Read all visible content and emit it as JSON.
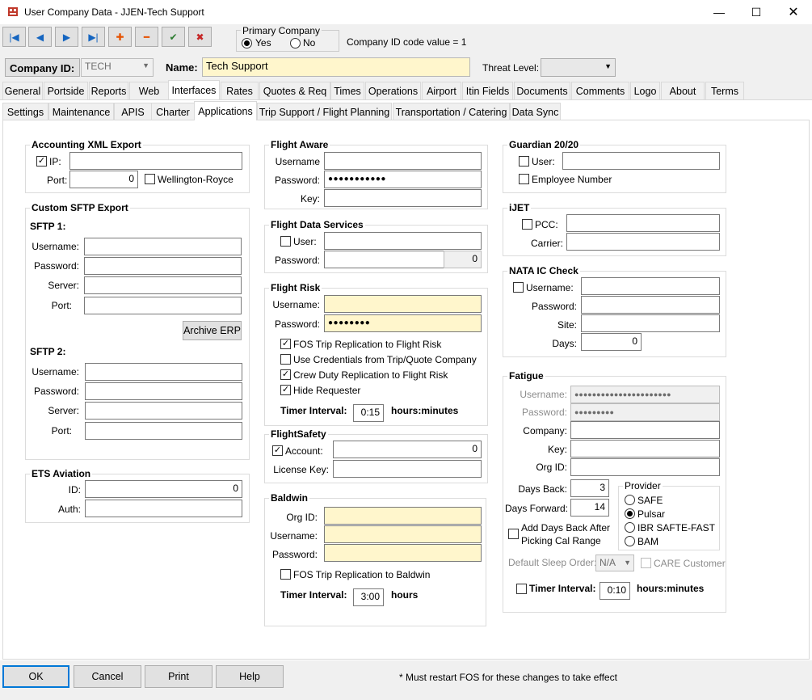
{
  "window": {
    "title": "User Company Data - JJEN-Tech Support"
  },
  "toolbar": {
    "buttons": [
      {
        "name": "first-record-button",
        "glyph": "|◀",
        "color": "#1565c0"
      },
      {
        "name": "prev-record-button",
        "glyph": "◀",
        "color": "#1565c0"
      },
      {
        "name": "next-record-button",
        "glyph": "▶",
        "color": "#1565c0"
      },
      {
        "name": "last-record-button",
        "glyph": "▶|",
        "color": "#1565c0"
      },
      {
        "name": "add-record-button",
        "glyph": "✚",
        "color": "#e65100"
      },
      {
        "name": "delete-record-button",
        "glyph": "━",
        "color": "#e65100"
      },
      {
        "name": "save-record-button",
        "glyph": "✔",
        "color": "#2e7d32"
      },
      {
        "name": "cancel-record-button",
        "glyph": "✖",
        "color": "#c62828"
      }
    ]
  },
  "primary": {
    "legend": "Primary Company",
    "yes": "Yes",
    "no": "No",
    "idtext": "Company ID code value = 1"
  },
  "header": {
    "company_id_label": "Company ID:",
    "company_id": "TECH",
    "name_label": "Name:",
    "name": "Tech Support",
    "threat_label": "Threat Level:",
    "threat": ""
  },
  "tabs": [
    "General",
    "Portside",
    "Reports",
    "Web",
    "Interfaces",
    "Rates",
    "Quotes & Req",
    "Times",
    "Operations",
    "Airport",
    "Itin Fields",
    "Documents",
    "Comments",
    "Logo",
    "About",
    "Terms"
  ],
  "subtabs": [
    "Settings",
    "Maintenance",
    "APIS",
    "Charter",
    "Applications",
    "Trip Support / Flight Planning",
    "Transportation / Catering",
    "Data Sync"
  ],
  "axml": {
    "title": "Accounting XML Export",
    "ip_label": "IP:",
    "ip": "",
    "port_label": "Port:",
    "port": "0",
    "wellington": "Wellington-Royce"
  },
  "sftp": {
    "title": "Custom SFTP Export",
    "sftp1": "SFTP 1:",
    "sftp2": "SFTP 2:",
    "username": "Username:",
    "password": "Password:",
    "server": "Server:",
    "port": "Port:",
    "archive": "Archive ERP"
  },
  "ets": {
    "title": "ETS Aviation",
    "id_label": "ID:",
    "id": "0",
    "auth_label": "Auth:"
  },
  "faware": {
    "title": "Flight Aware",
    "username": "Username",
    "password": "Password:",
    "password_value": "●●●●●●●●●●●",
    "key": "Key:"
  },
  "fds": {
    "title": "Flight Data Services",
    "user": "User:",
    "password": "Password:",
    "value": "0"
  },
  "frisk": {
    "title": "Flight Risk",
    "username": "Username:",
    "password": "Password:",
    "password_value": "●●●●●●●●",
    "opt1": "FOS Trip Replication to Flight Risk",
    "opt2": "Use Credentials from Trip/Quote Company",
    "opt3": "Crew Duty Replication to Flight Risk",
    "opt4": "Hide Requester",
    "timer": "Timer Interval:",
    "timer_value": "0:15",
    "unit": "hours:minutes"
  },
  "fsafety": {
    "title": "FlightSafety",
    "account": "Account:",
    "account_value": "0",
    "license": "License Key:"
  },
  "baldwin": {
    "title": "Baldwin",
    "orgid": "Org ID:",
    "username": "Username:",
    "password": "Password:",
    "opt": "FOS Trip Replication to Baldwin",
    "timer": "Timer Interval:",
    "timer_value": "3:00",
    "unit": "hours"
  },
  "guardian": {
    "title": "Guardian 20/20",
    "user": "User:",
    "employee": "Employee Number"
  },
  "ijet": {
    "title": "iJET",
    "pcc": "PCC:",
    "carrier": "Carrier:"
  },
  "nata": {
    "title": "NATA IC Check",
    "username": "Username:",
    "password": "Password:",
    "site": "Site:",
    "days": "Days:",
    "days_value": "0"
  },
  "fatigue": {
    "title": "Fatigue",
    "username": "Username:",
    "username_value": "●●●●●●●●●●●●●●●●●●●●●●",
    "password": "Password:",
    "password_value": "●●●●●●●●●",
    "company": "Company:",
    "key": "Key:",
    "orgid": "Org ID:",
    "days_back": "Days Back:",
    "days_back_value": "3",
    "days_forward": "Days Forward:",
    "days_forward_value": "14",
    "add_days": "Add Days Back After",
    "picking": "Picking Cal Range",
    "provider": "Provider",
    "p1": "SAFE",
    "p2": "Pulsar",
    "p3": "IBR SAFTE-FAST",
    "p4": "BAM",
    "sleep": "Default Sleep Order:",
    "sleep_value": "N/A",
    "care": "CARE Customer",
    "timer": "Timer Interval:",
    "timer_value": "0:10",
    "unit": "hours:minutes"
  },
  "bottom": {
    "ok": "OK",
    "cancel": "Cancel",
    "print": "Print",
    "help": "Help",
    "note": "* Must restart FOS for these changes to take effect"
  }
}
